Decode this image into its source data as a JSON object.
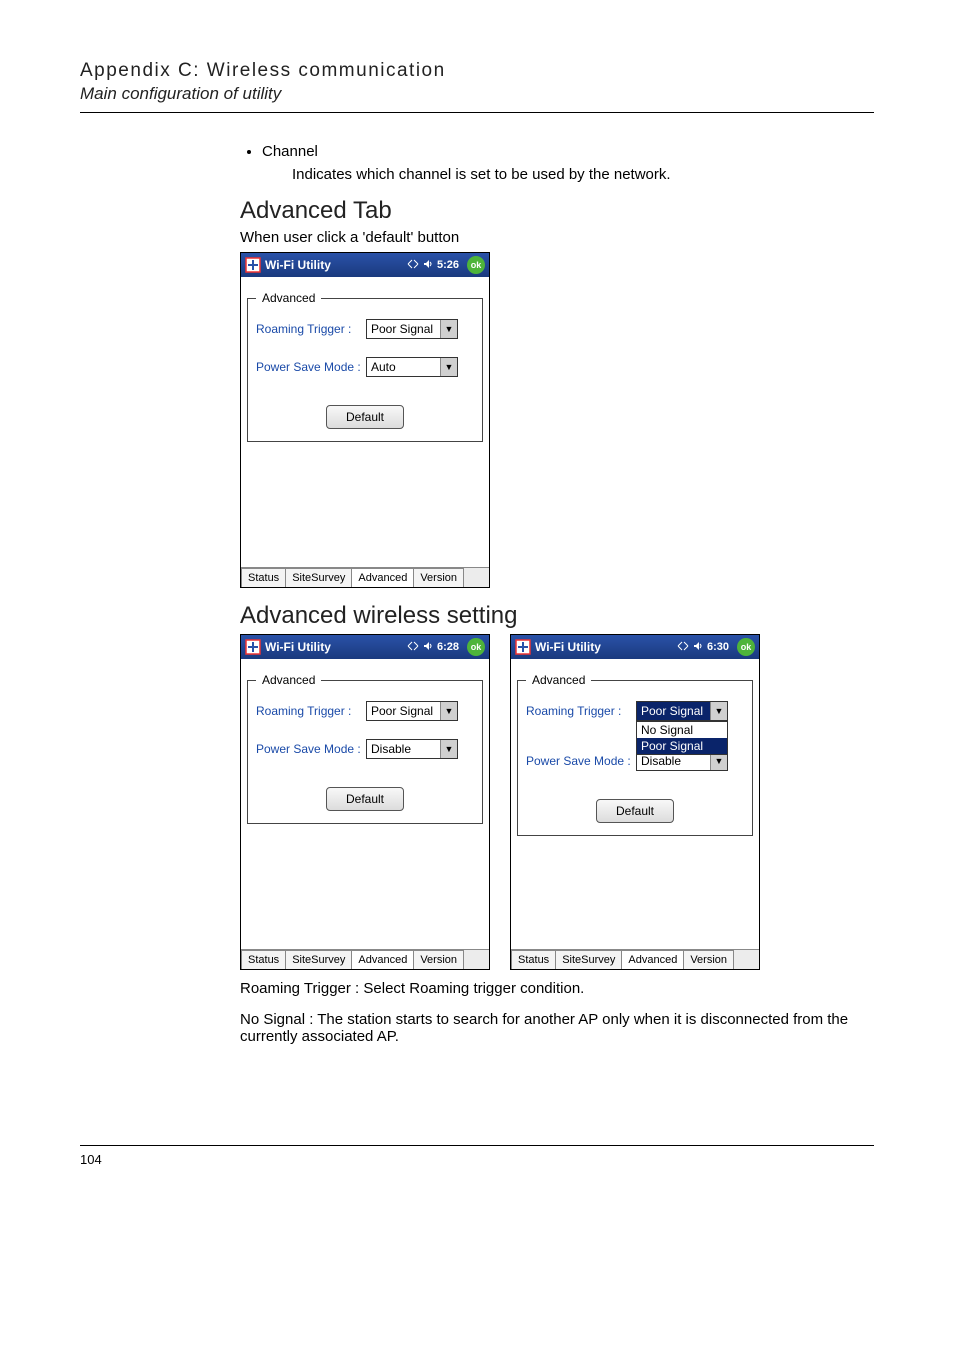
{
  "header": {
    "title": "Appendix C: Wireless communication",
    "subtitle": "Main configuration of utility"
  },
  "bullet": {
    "name": "Channel",
    "desc": "Indicates which channel is set to be used by the network."
  },
  "section1": {
    "heading": "Advanced Tab",
    "desc": "When user click a 'default' button"
  },
  "section2": {
    "heading": "Advanced wireless setting"
  },
  "wifi": {
    "app_title": "Wi-Fi Utility",
    "ok": "ok",
    "fieldset_legend": "Advanced",
    "roaming_label": "Roaming Trigger :",
    "power_label": "Power Save Mode :",
    "default_btn": "Default",
    "tabs": [
      "Status",
      "SiteSurvey",
      "Advanced",
      "Version"
    ],
    "options": {
      "no_signal": "No Signal",
      "poor_signal": "Poor Signal"
    },
    "shot1": {
      "time": "5:26",
      "roaming": "Poor Signal",
      "power": "Auto"
    },
    "shot2": {
      "time": "6:28",
      "roaming": "Poor Signal",
      "power": "Disable"
    },
    "shot3": {
      "time": "6:30",
      "roaming": "Poor Signal",
      "power": "Disable"
    }
  },
  "trail": {
    "roaming_desc": "Roaming Trigger : Select Roaming trigger condition.",
    "nosignal_desc": "No Signal : The station starts to search for another AP only when it is disconnected from the currently associated AP."
  },
  "page_number": "104"
}
